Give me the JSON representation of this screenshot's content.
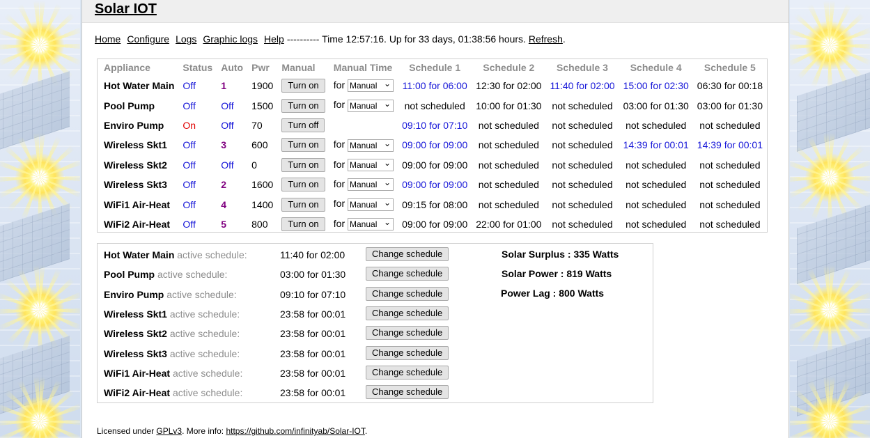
{
  "app": {
    "title": "Solar IOT"
  },
  "nav": {
    "home": "Home",
    "configure": "Configure",
    "logs": "Logs",
    "graphic_logs": "Graphic logs",
    "help": "Help",
    "status_text": "---------- Time 12:57:16. Up for 33 days, 01:38:56 hours.",
    "refresh": "Refresh",
    "refresh_suffix": "."
  },
  "table": {
    "headers": [
      "Appliance",
      "Status",
      "Auto",
      "Pwr",
      "Manual",
      "Manual Time",
      "Schedule 1",
      "Schedule 2",
      "Schedule 3",
      "Schedule 4",
      "Schedule 5"
    ],
    "manual_time_prefix": "for",
    "rows": [
      {
        "name": "Hot Water Main",
        "status": "Off",
        "auto": "1",
        "pwr": "1900",
        "button": "Turn on",
        "select": "Manual",
        "s1": "11:00 for 06:00",
        "s2": "12:30 for 02:00",
        "s3": "11:40 for 02:00",
        "s4": "15:00 for 02:30",
        "s5": "06:30 for 00:18"
      },
      {
        "name": "Pool Pump",
        "status": "Off",
        "auto": "Off",
        "pwr": "1500",
        "button": "Turn on",
        "select": "Manual",
        "s1": "not scheduled",
        "s2": "10:00 for 01:30",
        "s3": "not scheduled",
        "s4": "03:00 for 01:30",
        "s5": "03:00 for 01:30"
      },
      {
        "name": "Enviro Pump",
        "status": "On",
        "auto": "Off",
        "pwr": "70",
        "button": "Turn off",
        "select": "",
        "s1": "09:10 for 07:10",
        "s2": "not scheduled",
        "s3": "not scheduled",
        "s4": "not scheduled",
        "s5": "not scheduled"
      },
      {
        "name": "Wireless Skt1",
        "status": "Off",
        "auto": "3",
        "pwr": "600",
        "button": "Turn on",
        "select": "Manual",
        "s1": "09:00 for 09:00",
        "s2": "not scheduled",
        "s3": "not scheduled",
        "s4": "14:39 for 00:01",
        "s5": "14:39 for 00:01"
      },
      {
        "name": "Wireless Skt2",
        "status": "Off",
        "auto": "Off",
        "pwr": "0",
        "button": "Turn on",
        "select": "Manual",
        "s1": "09:00 for 09:00",
        "s2": "not scheduled",
        "s3": "not scheduled",
        "s4": "not scheduled",
        "s5": "not scheduled"
      },
      {
        "name": "Wireless Skt3",
        "status": "Off",
        "auto": "2",
        "pwr": "1600",
        "button": "Turn on",
        "select": "Manual",
        "s1": "09:00 for 09:00",
        "s2": "not scheduled",
        "s3": "not scheduled",
        "s4": "not scheduled",
        "s5": "not scheduled"
      },
      {
        "name": "WiFi1 Air-Heat",
        "status": "Off",
        "auto": "4",
        "pwr": "1400",
        "button": "Turn on",
        "select": "Manual",
        "s1": "09:15 for 08:00",
        "s2": "not scheduled",
        "s3": "not scheduled",
        "s4": "not scheduled",
        "s5": "not scheduled"
      },
      {
        "name": "WiFi2 Air-Heat",
        "status": "Off",
        "auto": "5",
        "pwr": "800",
        "button": "Turn on",
        "select": "Manual",
        "s1": "09:00 for 09:00",
        "s2": "22:00 for 01:00",
        "s3": "not scheduled",
        "s4": "not scheduled",
        "s5": "not scheduled"
      }
    ]
  },
  "active": {
    "suffix": "active schedule:",
    "button": "Change schedule",
    "rows": [
      {
        "name": "Hot Water Main",
        "time": "11:40 for 02:00"
      },
      {
        "name": "Pool Pump",
        "time": "03:00 for 01:30"
      },
      {
        "name": "Enviro Pump",
        "time": "09:10 for 07:10"
      },
      {
        "name": "Wireless Skt1",
        "time": "23:58 for 00:01"
      },
      {
        "name": "Wireless Skt2",
        "time": "23:58 for 00:01"
      },
      {
        "name": "Wireless Skt3",
        "time": "23:58 for 00:01"
      },
      {
        "name": "WiFi1 Air-Heat",
        "time": "23:58 for 00:01"
      },
      {
        "name": "WiFi2 Air-Heat",
        "time": "23:58 for 00:01"
      }
    ]
  },
  "stats": {
    "surplus": "Solar Surplus : 335 Watts",
    "power": "Solar Power : 819 Watts",
    "lag": "Power Lag : 800 Watts"
  },
  "footer": {
    "prefix": "Licensed under ",
    "license": "GPLv3",
    "middle": ". More info: ",
    "url": "https://github.com/infinityab/Solar-IOT",
    "suffix": "."
  },
  "colors": {
    "link_blue": "#1515d8",
    "status_on": "#e00000",
    "auto_purple": "#800080",
    "header_grey": "#8c8c8c"
  },
  "icons": {
    "select_arrow": "chevron-down-icon"
  }
}
